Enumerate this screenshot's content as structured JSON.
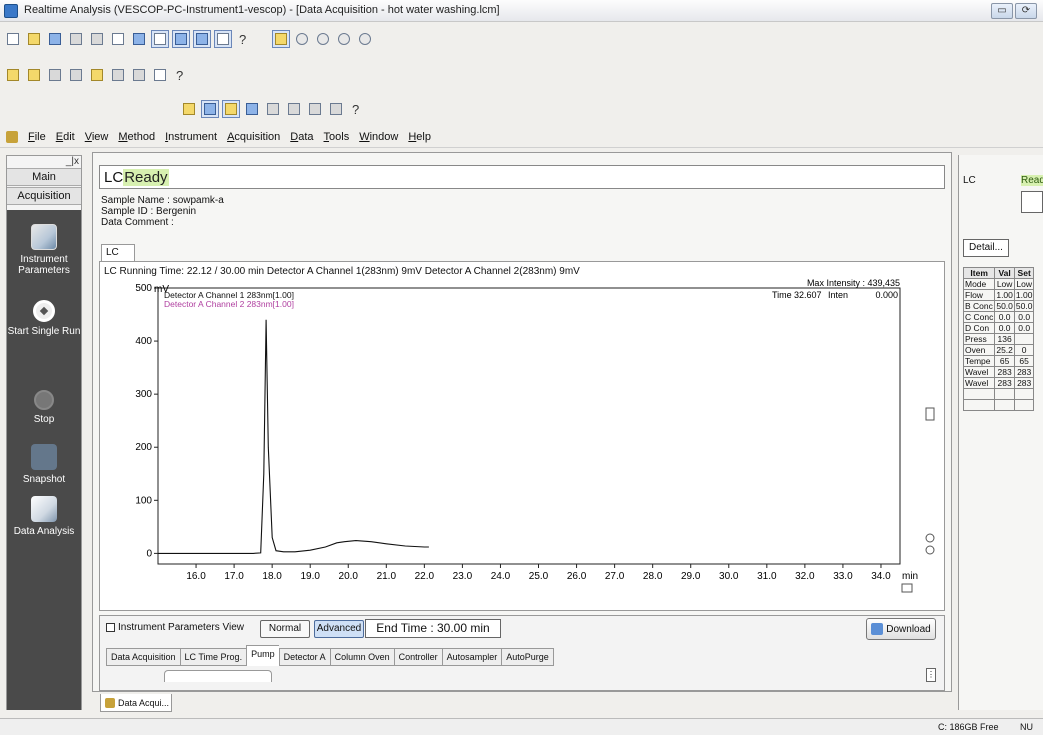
{
  "window": {
    "title": "Realtime Analysis (VESCOP-PC-Instrument1-vescop) - [Data Acquisition - hot water washing.lcm]",
    "restore_label": "▭",
    "extra_label": "⟳"
  },
  "toolbar1": {
    "help": "?"
  },
  "toolbar2": {
    "help": "?"
  },
  "toolbar3": {
    "help": "?"
  },
  "menu": [
    "File",
    "Edit",
    "View",
    "Method",
    "Instrument",
    "Acquisition",
    "Data",
    "Tools",
    "Window",
    "Help"
  ],
  "leftnav": {
    "close": "_|x",
    "main_label": "Main",
    "acq_label": "Acquisition",
    "items": [
      {
        "label": "Instrument Parameters",
        "icon": "instrument-parameters-icon"
      },
      {
        "label": "Start Single Run",
        "icon": "start-run-icon"
      },
      {
        "label": "Stop",
        "icon": "stop-icon"
      },
      {
        "label": "Snapshot",
        "icon": "snapshot-icon"
      },
      {
        "label": "Data Analysis",
        "icon": "data-analysis-icon"
      }
    ]
  },
  "main": {
    "status_prefix": "LC",
    "status": "Ready",
    "sample_name": "Sample Name : sowpamk-a",
    "sample_id": "Sample ID : Bergenin",
    "data_comment": "Data Comment :",
    "tab_label": "LC",
    "running_info": "LC Running Time: 22.12 / 30.00 min Detector A Channel 1(283nm) 9mV Detector A Channel 2(283nm) 9mV"
  },
  "chart_data": {
    "type": "line",
    "ylabel": "mV",
    "xlabel": "min",
    "ylim": [
      -20,
      500
    ],
    "xlim": [
      15.0,
      34.5
    ],
    "y_ticks": [
      "500",
      "400",
      "300",
      "200",
      "100",
      "0"
    ],
    "x_ticks": [
      "16.0",
      "17.0",
      "18.0",
      "19.0",
      "20.0",
      "21.0",
      "22.0",
      "23.0",
      "24.0",
      "25.0",
      "26.0",
      "27.0",
      "28.0",
      "29.0",
      "30.0",
      "31.0",
      "32.0",
      "33.0",
      "34.0"
    ],
    "legend": [
      "Detector A Channel 1 283nm[1.00]",
      "Detector A Channel 2 283nm[1.00]"
    ],
    "max_intensity": "Max Intensity : 439,435",
    "readout_time_label": "Time",
    "readout_time": "32.607",
    "readout_inten_label": "Inten",
    "readout_inten": "0.000",
    "series": [
      {
        "name": "Detector A Channel 1 283nm[1.00]",
        "color": "#111111",
        "x": [
          15.0,
          16.0,
          17.0,
          17.5,
          17.7,
          17.78,
          17.84,
          17.9,
          18.0,
          18.1,
          18.3,
          18.6,
          19.0,
          19.4,
          19.7,
          19.9,
          20.2,
          20.6,
          21.0,
          21.5,
          22.0,
          22.12
        ],
        "y": [
          0,
          0,
          0,
          0,
          1,
          150,
          440,
          200,
          30,
          5,
          3,
          3,
          6,
          12,
          20,
          22,
          24,
          22,
          18,
          14,
          12,
          12
        ]
      },
      {
        "name": "Detector A Channel 2 283nm[1.00]",
        "color": "#b040a0",
        "x": [],
        "y": []
      }
    ]
  },
  "params": {
    "title": "Instrument Parameters View",
    "normal": "Normal",
    "advanced": "Advanced",
    "end_time": "End Time : 30.00 min",
    "download": "Download",
    "tabs": [
      "Data Acquisition",
      "LC Time Prog.",
      "Pump",
      "Detector A",
      "Column Oven",
      "Controller",
      "Autosampler",
      "AutoPurge"
    ],
    "active_tab": "Pump"
  },
  "doc_tab": "Data Acqui...",
  "right": {
    "lc": "LC",
    "ready": "Read",
    "detail": "Detail...",
    "headers": [
      "Item",
      "Val",
      "Set"
    ],
    "rows": [
      [
        "Mode",
        "Low",
        "Low"
      ],
      [
        "Flow",
        "1.00",
        "1.00"
      ],
      [
        "B Conc",
        "50.0",
        "50.0"
      ],
      [
        "C Conc",
        "0.0",
        "0.0"
      ],
      [
        "D Con",
        "0.0",
        "0.0"
      ],
      [
        "Press",
        "136",
        ""
      ],
      [
        "Oven",
        "25.2",
        "0"
      ],
      [
        "Tempe",
        "65",
        "65"
      ],
      [
        "Wavel",
        "283",
        "283"
      ],
      [
        "Wavel",
        "283",
        "283"
      ]
    ]
  },
  "statusbar": {
    "free": "C: 186GB Free",
    "num": "NU"
  }
}
